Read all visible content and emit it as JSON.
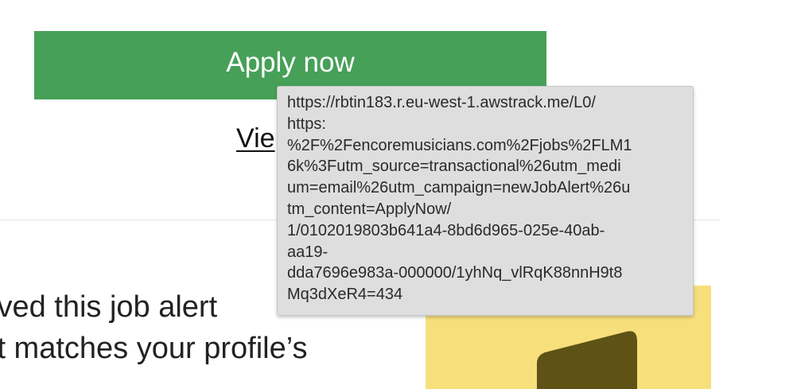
{
  "apply_button": {
    "label": "Apply now"
  },
  "view_link": {
    "visible_text": "Vie"
  },
  "footer": {
    "lines": [
      "ived this job alert",
      " it matches your profile’s"
    ]
  },
  "tooltip": {
    "lines": [
      "https://rbtin183.r.eu-west-1.awstrack.me/L0/",
      "https:",
      "%2F%2Fencoremusicians.com%2Fjobs%2FLM1",
      "6k%3Futm_source=transactional%26utm_medi",
      "um=email%26utm_campaign=newJobAlert%26u",
      "tm_content=ApplyNow/",
      "1/0102019803b641a4-8bd6d965-025e-40ab-",
      "aa19-",
      "dda7696e983a-000000/1yhNq_vlRqK88nnH9t8",
      "Mq3dXeR4=434"
    ]
  },
  "promo": {
    "icon": "music-note-icon",
    "background_color": "#f7df7c",
    "icon_color": "#5e5214"
  },
  "colors": {
    "apply_button": "#46a058",
    "tooltip_background": "#dedede"
  }
}
